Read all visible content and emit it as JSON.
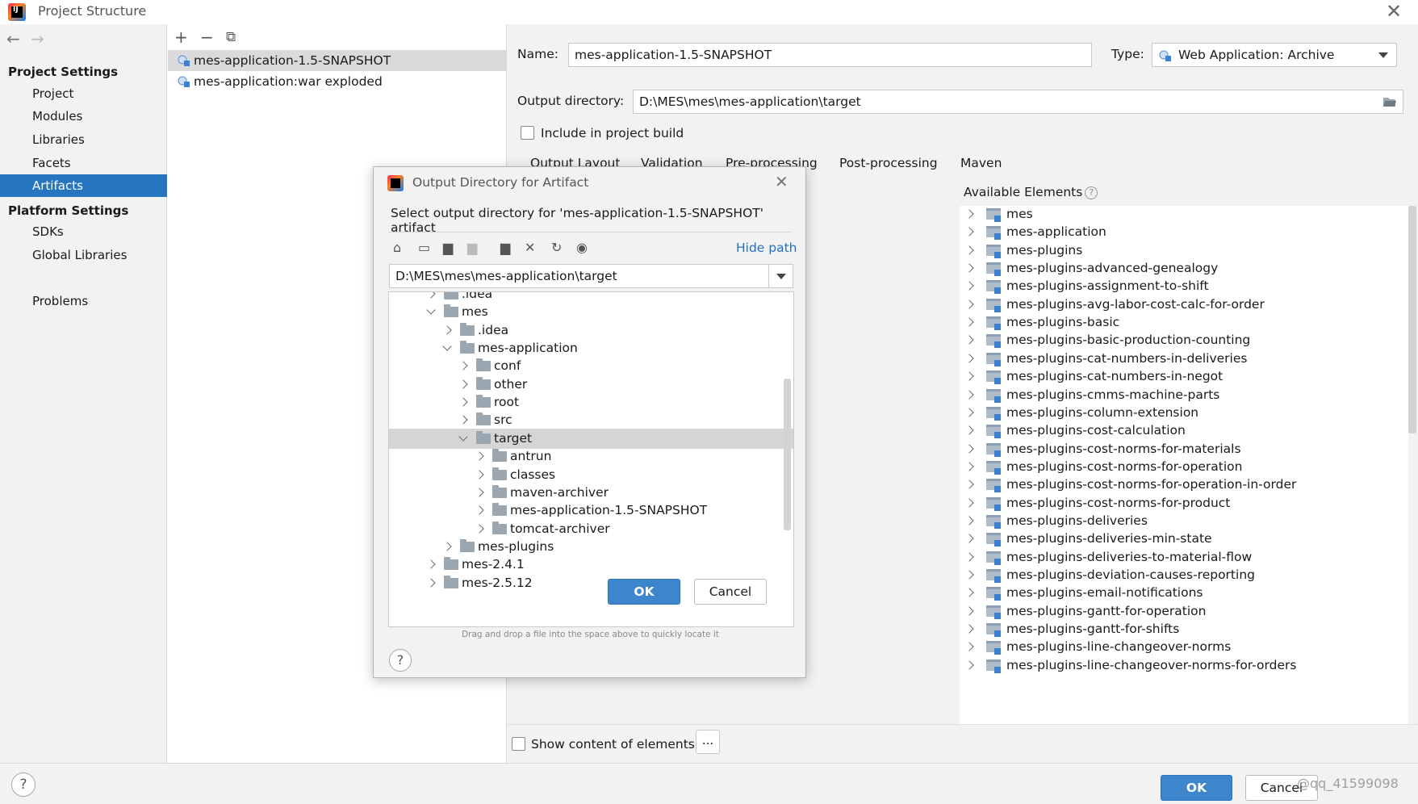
{
  "window": {
    "title": "Project Structure"
  },
  "sidebar": {
    "project_settings_header": "Project Settings",
    "project_items": [
      "Project",
      "Modules",
      "Libraries",
      "Facets",
      "Artifacts"
    ],
    "platform_settings_header": "Platform Settings",
    "platform_items": [
      "SDKs",
      "Global Libraries"
    ],
    "problems": "Problems",
    "selected": "Artifacts"
  },
  "artifacts": {
    "items": [
      "mes-application-1.5-SNAPSHOT",
      "mes-application:war exploded"
    ],
    "selected": "mes-application-1.5-SNAPSHOT"
  },
  "editor": {
    "name_label": "Name:",
    "name_value": "mes-application-1.5-SNAPSHOT",
    "type_label": "Type:",
    "type_value": "Web Application: Archive",
    "output_label": "Output directory:",
    "output_value": "D:\\MES\\mes\\mes-application\\target",
    "include_build": "Include in project build",
    "tabs": [
      "Output Layout",
      "Validation",
      "Pre-processing",
      "Post-processing",
      "Maven"
    ],
    "available_elements": "Available Elements",
    "elements": [
      "mes",
      "mes-application",
      "mes-plugins",
      "mes-plugins-advanced-genealogy",
      "mes-plugins-assignment-to-shift",
      "mes-plugins-avg-labor-cost-calc-for-order",
      "mes-plugins-basic",
      "mes-plugins-basic-production-counting",
      "mes-plugins-cat-numbers-in-deliveries",
      "mes-plugins-cat-numbers-in-negot",
      "mes-plugins-cmms-machine-parts",
      "mes-plugins-column-extension",
      "mes-plugins-cost-calculation",
      "mes-plugins-cost-norms-for-materials",
      "mes-plugins-cost-norms-for-operation",
      "mes-plugins-cost-norms-for-operation-in-order",
      "mes-plugins-cost-norms-for-product",
      "mes-plugins-deliveries",
      "mes-plugins-deliveries-min-state",
      "mes-plugins-deliveries-to-material-flow",
      "mes-plugins-deviation-causes-reporting",
      "mes-plugins-email-notifications",
      "mes-plugins-gantt-for-operation",
      "mes-plugins-gantt-for-shifts",
      "mes-plugins-line-changeover-norms",
      "mes-plugins-line-changeover-norms-for-orders"
    ],
    "show_content": "Show content of elements",
    "dots": "..."
  },
  "footer": {
    "ok": "OK",
    "cancel": "Cancel",
    "watermark": "@qq_41599098"
  },
  "dialog": {
    "title": "Output Directory for Artifact",
    "description": "Select output directory for 'mes-application-1.5-SNAPSHOT' artifact",
    "hide_path": "Hide path",
    "path": "D:\\MES\\mes\\mes-application\\target",
    "tree": [
      {
        "label": ".idea",
        "depth": 0,
        "expanded": false
      },
      {
        "label": "mes",
        "depth": 0,
        "expanded": true
      },
      {
        "label": ".idea",
        "depth": 1,
        "expanded": false
      },
      {
        "label": "mes-application",
        "depth": 1,
        "expanded": true
      },
      {
        "label": "conf",
        "depth": 2,
        "expanded": false
      },
      {
        "label": "other",
        "depth": 2,
        "expanded": false
      },
      {
        "label": "root",
        "depth": 2,
        "expanded": false
      },
      {
        "label": "src",
        "depth": 2,
        "expanded": false
      },
      {
        "label": "target",
        "depth": 2,
        "expanded": true,
        "selected": true
      },
      {
        "label": "antrun",
        "depth": 3,
        "expanded": false
      },
      {
        "label": "classes",
        "depth": 3,
        "expanded": false
      },
      {
        "label": "maven-archiver",
        "depth": 3,
        "expanded": false
      },
      {
        "label": "mes-application-1.5-SNAPSHOT",
        "depth": 3,
        "expanded": false
      },
      {
        "label": "tomcat-archiver",
        "depth": 3,
        "expanded": false
      },
      {
        "label": "mes-plugins",
        "depth": 1,
        "expanded": false
      },
      {
        "label": "mes-2.4.1",
        "depth": 0,
        "expanded": false
      },
      {
        "label": "mes-2.5.12",
        "depth": 0,
        "expanded": false
      }
    ],
    "hint": "Drag and drop a file into the space above to quickly locate it",
    "ok": "OK",
    "cancel": "Cancel"
  }
}
